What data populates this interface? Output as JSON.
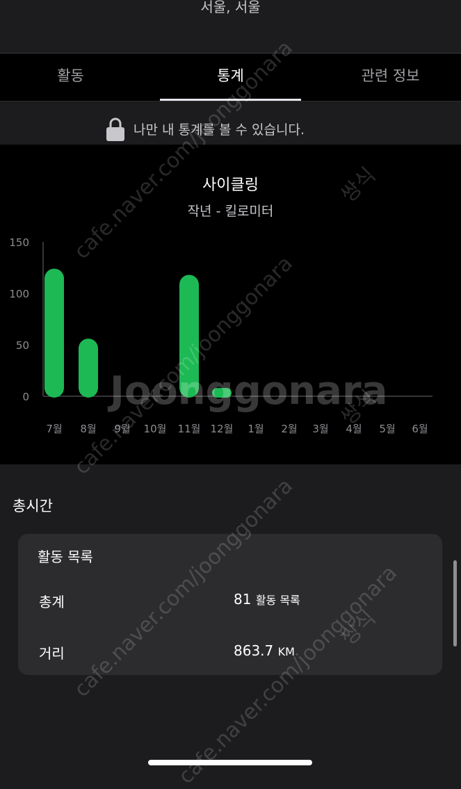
{
  "location": "서울, 서울",
  "tabs": [
    {
      "label": "활동"
    },
    {
      "label": "통계"
    },
    {
      "label": "관련 정보"
    }
  ],
  "active_tab": "통계",
  "privacy_note": "나만 내 통계를 볼 수 있습니다.",
  "chart_title": "사이클링",
  "chart_subtitle": "작년 - 킬로미터",
  "chart_data": {
    "type": "bar",
    "title": "사이클링",
    "subtitle": "작년 - 킬로미터",
    "categories": [
      "7월",
      "8월",
      "9월",
      "10월",
      "11월",
      "12월",
      "1월",
      "2월",
      "3월",
      "4월",
      "5월",
      "6월"
    ],
    "values": [
      124,
      56,
      0,
      0,
      118,
      8,
      0,
      0,
      0,
      0,
      0,
      0
    ],
    "y_ticks": [
      "0",
      "50",
      "100",
      "150"
    ],
    "ylim": [
      0,
      150
    ],
    "bar_color": "#1db954"
  },
  "section_title": "총시간",
  "card": {
    "title": "활동 목록",
    "rows": [
      {
        "label": "총계",
        "value": "81",
        "unit": "활동 목록"
      },
      {
        "label": "거리",
        "value": "863.7",
        "unit": "KM"
      }
    ]
  },
  "watermarks": {
    "site": "cafe.naver.com/joonggonara",
    "brand": "Joonggonara",
    "stamp": "쌍식"
  },
  "icons": {
    "lock": "lock-icon"
  }
}
